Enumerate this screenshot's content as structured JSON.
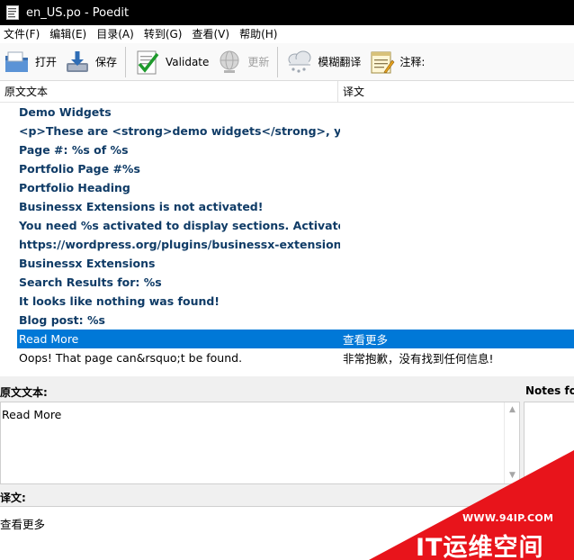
{
  "window": {
    "title": "en_US.po - Poedit",
    "icon": "po-file-icon"
  },
  "menu": [
    "文件(F)",
    "编辑(E)",
    "目录(A)",
    "转到(G)",
    "查看(V)",
    "帮助(H)"
  ],
  "toolbar": {
    "open_label": "打开",
    "save_label": "保存",
    "validate_label": "Validate",
    "update_label": "更新",
    "fuzzy_label": "模糊翻译",
    "comment_label": "注释:"
  },
  "list": {
    "header_source": "原文文本",
    "header_translation": "译文",
    "rows": [
      {
        "source": "Demo Widgets",
        "translation": ""
      },
      {
        "source": "<p>These are <strong>demo widgets</strong>, you c...",
        "translation": ""
      },
      {
        "source": "Page #: %s of %s",
        "translation": ""
      },
      {
        "source": "Portfolio Page #%s",
        "translation": ""
      },
      {
        "source": "Portfolio Heading",
        "translation": ""
      },
      {
        "source": "Businessx Extensions is not activated!",
        "translation": ""
      },
      {
        "source": "You need %s activated to display sections. Activate the ...",
        "translation": ""
      },
      {
        "source": "https://wordpress.org/plugins/businessx-extensions/",
        "translation": ""
      },
      {
        "source": "Businessx Extensions",
        "translation": ""
      },
      {
        "source": "Search Results for: %s",
        "translation": ""
      },
      {
        "source": "It looks like nothing was found!",
        "translation": ""
      },
      {
        "source": "Blog post: %s",
        "translation": ""
      },
      {
        "source": "Read More",
        "translation": "查看更多"
      },
      {
        "source": "Oops! That page can&rsquo;t be found.",
        "translation": "非常抱歉，没有找到任何信息!"
      }
    ],
    "selected_index": 12
  },
  "editor": {
    "source_label": "原文文本:",
    "source_text": "Read More",
    "translation_label": "译文:",
    "translation_text": "查看更多"
  },
  "notes": {
    "label": "Notes fo"
  },
  "watermark": {
    "url": "WWW.94IP.COM",
    "text": "IT运维空间"
  },
  "colors": {
    "selection": "#0078d7",
    "untranslated": "#0f3b66",
    "titlebar": "#000000",
    "watermark": "#e8141b"
  }
}
